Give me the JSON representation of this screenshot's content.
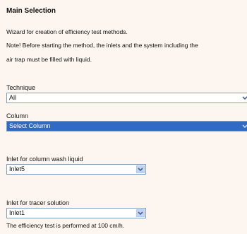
{
  "header": {
    "title": "Main Selection"
  },
  "intro": {
    "line1": "Wizard for creation of efficiency test methods.",
    "line2": "Note! Before starting the method, the inlets and the system including the",
    "line3": "air trap must be filled with liquid."
  },
  "technique": {
    "label": "Technique",
    "value": "All"
  },
  "column": {
    "label": "Column",
    "value": "Select Column"
  },
  "wash_inlet": {
    "label": "Inlet for column wash liquid",
    "value": "Inlet5"
  },
  "tracer_inlet": {
    "label": "Inlet for tracer solution",
    "value": "Inlet1"
  },
  "footer": {
    "note": "The efficiency test is performed at 100 cm/h."
  },
  "colors": {
    "background": "#fdf5ef",
    "selection_highlight": "#316ac5",
    "field_border": "#7f9db9",
    "arrow_color": "#4d6185"
  },
  "icons": {
    "dropdown": "chevron-down-icon"
  }
}
